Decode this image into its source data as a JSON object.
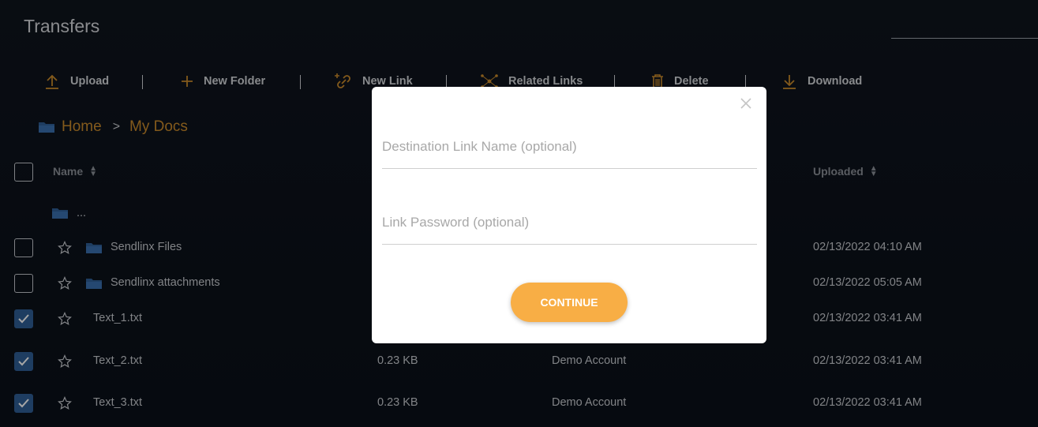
{
  "app": {
    "title": "Transfers"
  },
  "toolbar": {
    "upload": "Upload",
    "new_folder": "New Folder",
    "new_link": "New Link",
    "related_links": "Related Links",
    "delete": "Delete",
    "download": "Download"
  },
  "breadcrumb": {
    "home": "Home",
    "separator": ">",
    "current": "My Docs"
  },
  "table": {
    "headers": {
      "name": "Name",
      "uploaded": "Uploaded"
    },
    "parent_row": {
      "label": "..."
    },
    "rows": [
      {
        "name": "Sendlinx Files",
        "type": "folder",
        "size": "",
        "owner": "",
        "uploaded": "02/13/2022 04:10 AM",
        "checked": false
      },
      {
        "name": "Sendlinx attachments",
        "type": "folder",
        "size": "",
        "owner": "",
        "uploaded": "02/13/2022 05:05 AM",
        "checked": false
      },
      {
        "name": "Text_1.txt",
        "type": "file",
        "size": "",
        "owner": "",
        "uploaded": "02/13/2022 03:41 AM",
        "checked": true
      },
      {
        "name": "Text_2.txt",
        "type": "file",
        "size": "0.23 KB",
        "owner": "Demo Account",
        "uploaded": "02/13/2022 03:41 AM",
        "checked": true
      },
      {
        "name": "Text_3.txt",
        "type": "file",
        "size": "0.23 KB",
        "owner": "Demo Account",
        "uploaded": "02/13/2022 03:41 AM",
        "checked": true
      }
    ]
  },
  "modal": {
    "link_name_placeholder": "Destination Link Name (optional)",
    "link_name_value": "",
    "password_placeholder": "Link Password (optional)",
    "password_value": "",
    "continue_label": "CONTINUE"
  },
  "colors": {
    "accent": "#c98a2b",
    "button": "#f8ae45",
    "folder": "#2f5e95",
    "checkbox_checked": "#2f5e95",
    "background": "#0c111b"
  },
  "icons": {
    "upload": "upload-arrow-icon",
    "new_folder": "plus-icon",
    "new_link": "link-plus-icon",
    "related_links": "network-nodes-icon",
    "delete": "trash-icon",
    "download": "download-arrow-icon",
    "close": "close-x-icon",
    "folder": "folder-icon",
    "star": "star-outline-icon",
    "check": "checkmark-icon"
  }
}
